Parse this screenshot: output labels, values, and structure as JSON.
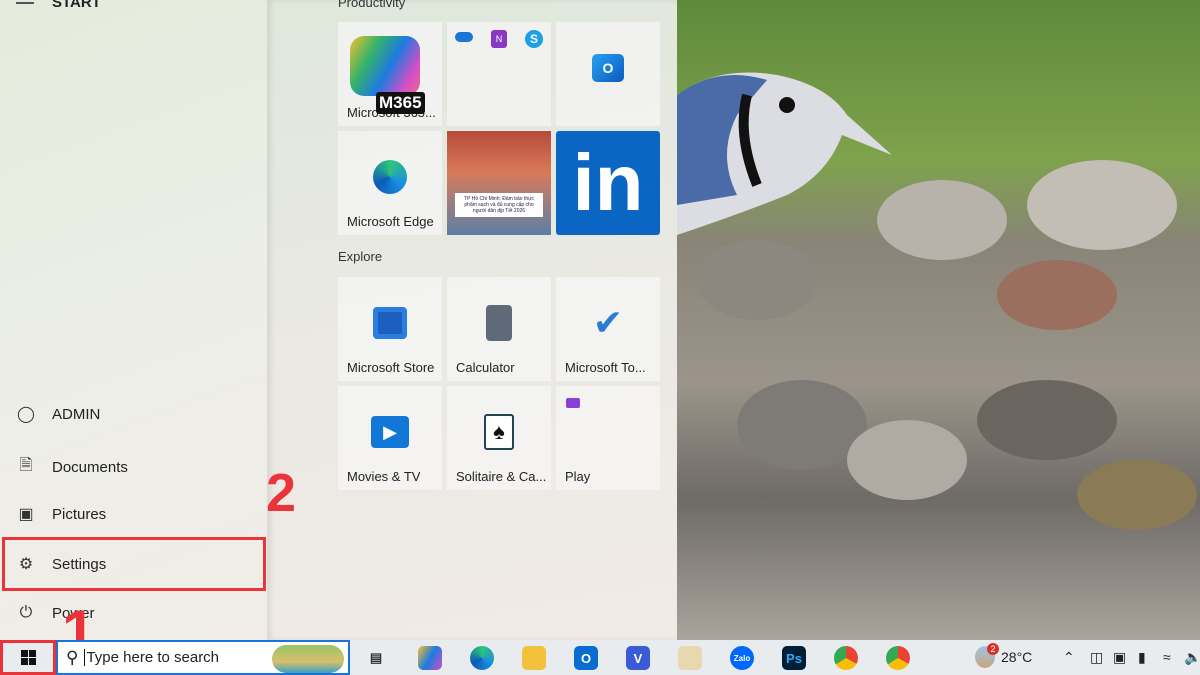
{
  "start_menu": {
    "title": "START",
    "user_items": [
      {
        "label": "ADMIN",
        "icon": "user-icon"
      },
      {
        "label": "Documents",
        "icon": "document-icon"
      },
      {
        "label": "Pictures",
        "icon": "pictures-icon"
      },
      {
        "label": "Settings",
        "icon": "gear-icon"
      },
      {
        "label": "Power",
        "icon": "power-icon"
      }
    ],
    "groups": [
      {
        "title": "Productivity",
        "tiles": [
          {
            "label": "Microsoft 365...",
            "badge": "M365"
          },
          {
            "label": ""
          },
          {
            "label": ""
          },
          {
            "label": "Microsoft Edge"
          },
          {
            "label": "",
            "news_text": "TP Hồ Chí Minh: Đảm bảo thực phẩm sạch và đủ cung cấp cho người dân dịp Tết 2026"
          },
          {
            "label": "",
            "logo_text": "in"
          }
        ]
      },
      {
        "title": "Explore",
        "tiles": [
          {
            "label": "Microsoft Store"
          },
          {
            "label": "Calculator"
          },
          {
            "label": "Microsoft To..."
          },
          {
            "label": "Movies & TV"
          },
          {
            "label": "Solitaire & Ca..."
          },
          {
            "label": "Play"
          }
        ]
      }
    ]
  },
  "annotations": {
    "step1": "1",
    "step2": "2",
    "color": "#e8343a"
  },
  "taskbar": {
    "search_placeholder": "Type here to search",
    "apps": [
      "task-view",
      "copilot",
      "edge",
      "file-explorer",
      "outlook",
      "viva",
      "paint",
      "zalo",
      "photoshop",
      "chrome",
      "chrome-profile"
    ],
    "zalo_label": "Zalo",
    "ps_label": "Ps",
    "weather_badge": "2",
    "temperature": "28°C"
  }
}
